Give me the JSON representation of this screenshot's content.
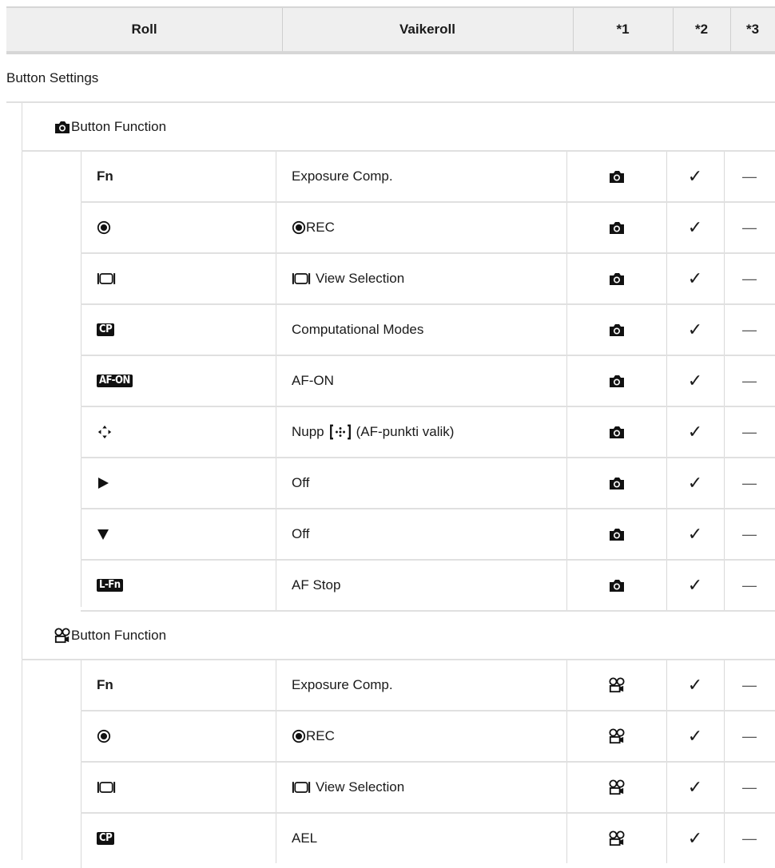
{
  "header": {
    "roll": "Roll",
    "vaikeroll": "Vaikeroll",
    "c1": "*1",
    "c2": "*2",
    "c3": "*3"
  },
  "button_settings_label": "Button Settings",
  "photo_section": {
    "label": "Button Function",
    "rows": [
      {
        "key_text": "Fn",
        "value": "Exposure Comp."
      },
      {
        "key_text": "",
        "value": "REC"
      },
      {
        "key_text": "",
        "value": "View Selection"
      },
      {
        "key_text": "CP",
        "value": "Computational Modes"
      },
      {
        "key_text": "AF-ON",
        "value": "AF-ON"
      },
      {
        "key_text": "",
        "value_pre": "Nupp",
        "value": "(AF-punkti valik)"
      },
      {
        "key_text": "",
        "value": "Off"
      },
      {
        "key_text": "",
        "value": "Off"
      },
      {
        "key_text": "L-Fn",
        "value": "AF Stop"
      }
    ]
  },
  "movie_section": {
    "label": "Button Function",
    "rows": [
      {
        "key_text": "Fn",
        "value": "Exposure Comp."
      },
      {
        "key_text": "",
        "value": "REC"
      },
      {
        "key_text": "",
        "value": "View Selection"
      },
      {
        "key_text": "CP",
        "value": "AEL"
      }
    ]
  },
  "marks": {
    "check": "✓",
    "dash": "—"
  },
  "icons": {
    "camera": "camera-icon",
    "movie": "movie-camera-icon",
    "rec": "rec-icon",
    "view": "view-selection-icon",
    "arrows": "four-way-arrows-icon",
    "right": "play-right-icon",
    "down": "triangle-down-icon",
    "af_point": "af-point-icon"
  }
}
